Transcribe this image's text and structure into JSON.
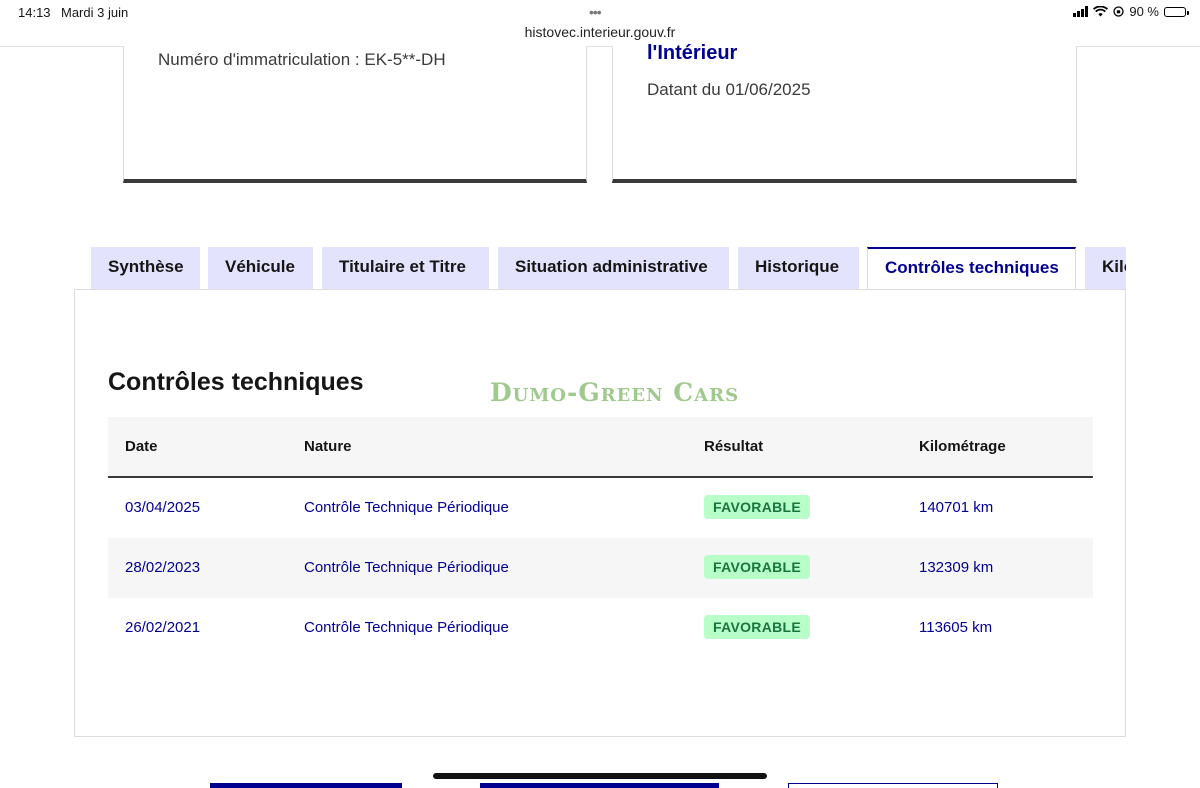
{
  "status_bar": {
    "time": "14:13",
    "date": "Mardi 3 juin",
    "dots": "•••",
    "url": "histovec.interieur.gouv.fr",
    "battery": "90 %"
  },
  "cards": {
    "registration": "Numéro d'immatriculation : EK-5**-DH",
    "ministry_fragment": "l'Intérieur",
    "date_label": "Datant du 01/06/2025"
  },
  "tabs": [
    {
      "label": "Synthèse"
    },
    {
      "label": "Véhicule"
    },
    {
      "label": "Titulaire et Titre"
    },
    {
      "label": "Situation administrative"
    },
    {
      "label": "Historique"
    },
    {
      "label": "Contrôles techniques"
    },
    {
      "label": "Kilométrage"
    }
  ],
  "active_tab": "Contrôles techniques",
  "panel": {
    "title": "Contrôles techniques",
    "watermark": "Dumo-Green Cars"
  },
  "table": {
    "headers": [
      "Date",
      "Nature",
      "Résultat",
      "Kilométrage"
    ],
    "rows": [
      {
        "date": "03/04/2025",
        "nature": "Contrôle Technique Périodique",
        "result": "FAVORABLE",
        "km": "140701 km"
      },
      {
        "date": "28/02/2023",
        "nature": "Contrôle Technique Périodique",
        "result": "FAVORABLE",
        "km": "132309 km"
      },
      {
        "date": "26/02/2021",
        "nature": "Contrôle Technique Périodique",
        "result": "FAVORABLE",
        "km": "113605 km"
      }
    ]
  },
  "colors": {
    "brand_blue": "#000091",
    "tab_bg": "#e3e3fd",
    "badge_bg": "#b8fec9",
    "badge_text": "#18753c"
  }
}
